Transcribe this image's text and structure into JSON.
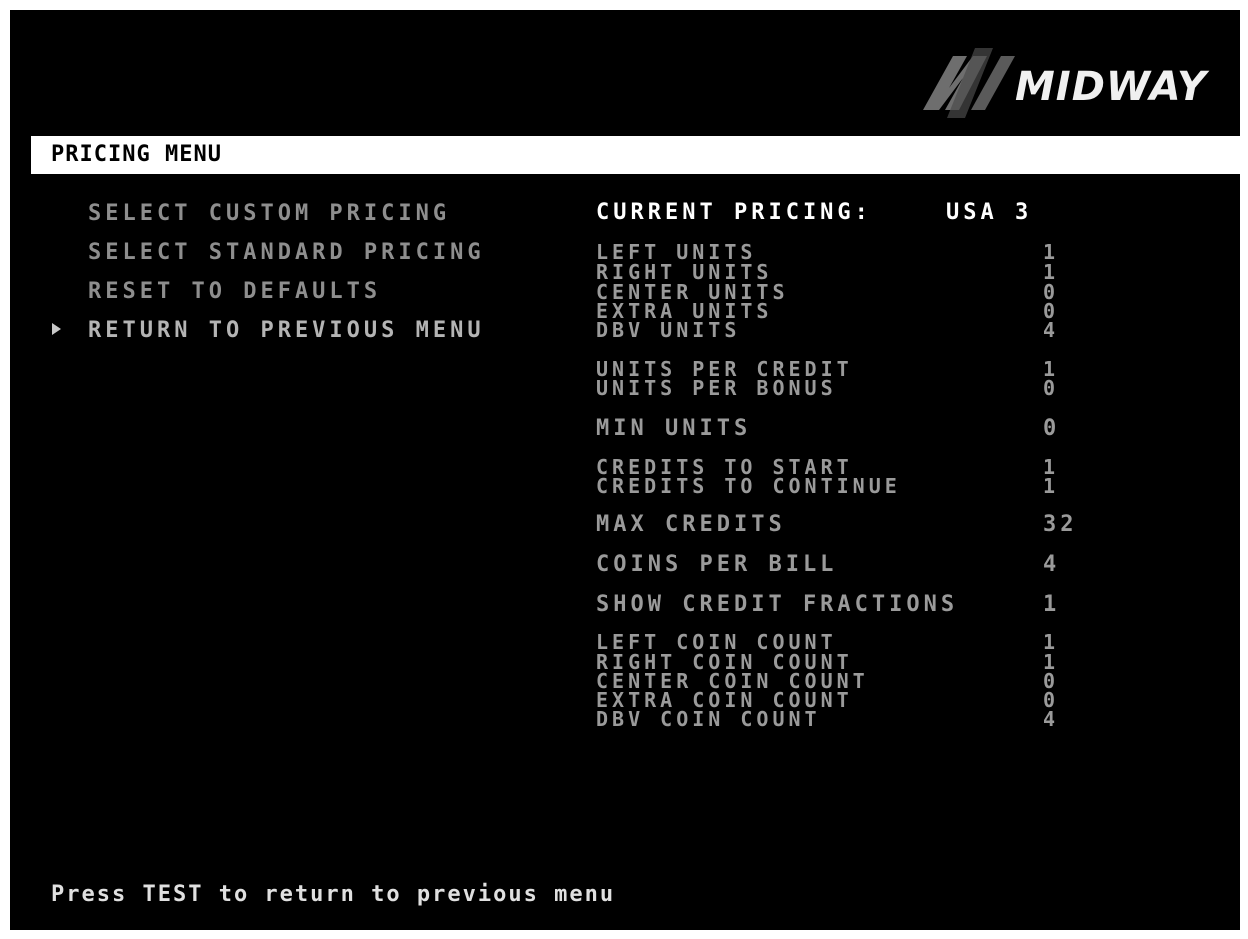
{
  "logo": {
    "text": "MIDWAY"
  },
  "header": {
    "title": "PRICING MENU"
  },
  "menu": {
    "items": [
      {
        "label": "SELECT CUSTOM PRICING"
      },
      {
        "label": "SELECT STANDARD PRICING"
      },
      {
        "label": "RESET TO DEFAULTS"
      },
      {
        "label": "RETURN TO PREVIOUS MENU",
        "selected": true
      }
    ],
    "cursor_icon": "right-triangle-icon"
  },
  "current_pricing": {
    "label": "CURRENT PRICING:",
    "value": "USA 3"
  },
  "settings": {
    "units": [
      {
        "label": "LEFT UNITS",
        "value": "1"
      },
      {
        "label": "RIGHT UNITS",
        "value": "1"
      },
      {
        "label": "CENTER UNITS",
        "value": "0"
      },
      {
        "label": "EXTRA UNITS",
        "value": "0"
      },
      {
        "label": "DBV UNITS",
        "value": "4"
      }
    ],
    "credit_units": [
      {
        "label": "UNITS PER CREDIT",
        "value": "1"
      },
      {
        "label": "UNITS PER BONUS",
        "value": "0"
      }
    ],
    "min_units": {
      "label": "MIN UNITS",
      "value": "0"
    },
    "credits": [
      {
        "label": "CREDITS TO START",
        "value": "1"
      },
      {
        "label": "CREDITS TO CONTINUE",
        "value": "1"
      }
    ],
    "max_credits": {
      "label": "MAX CREDITS",
      "value": "32"
    },
    "coins_per_bill": {
      "label": "COINS PER BILL",
      "value": "4"
    },
    "show_credit_fractions": {
      "label": "SHOW CREDIT FRACTIONS",
      "value": "1"
    },
    "coin_counts": [
      {
        "label": "LEFT COIN COUNT",
        "value": "1"
      },
      {
        "label": "RIGHT COIN COUNT",
        "value": "1"
      },
      {
        "label": "CENTER COIN COUNT",
        "value": "0"
      },
      {
        "label": "EXTRA COIN COUNT",
        "value": "0"
      },
      {
        "label": "DBV COIN COUNT",
        "value": "4"
      }
    ]
  },
  "footer": {
    "hint": "Press TEST to return to previous menu"
  },
  "colors": {
    "background": "#000000",
    "title_bar": "#ffffff",
    "menu_text": "#8e8e8e",
    "highlight_text": "#ffffff",
    "value_text": "#9a9a9a"
  }
}
